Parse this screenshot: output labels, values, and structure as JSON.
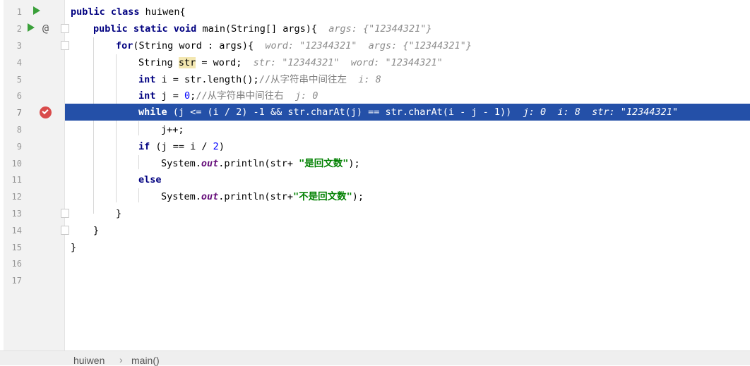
{
  "editor": {
    "lines": [
      {
        "n": "1"
      },
      {
        "n": "2"
      },
      {
        "n": "3"
      },
      {
        "n": "4"
      },
      {
        "n": "5"
      },
      {
        "n": "6"
      },
      {
        "n": "7"
      },
      {
        "n": "8"
      },
      {
        "n": "9"
      },
      {
        "n": "10"
      },
      {
        "n": "11"
      },
      {
        "n": "12"
      },
      {
        "n": "13"
      },
      {
        "n": "14"
      },
      {
        "n": "15"
      },
      {
        "n": "16"
      },
      {
        "n": "17"
      }
    ],
    "code": {
      "l1": {
        "kw": "public class",
        "rest": " huiwen{"
      },
      "l2": {
        "kw": "public static void",
        "rest": " main(String[] args){",
        "hint": "args: {\"12344321\"}"
      },
      "l3": {
        "kw": "for",
        "rest": "(String word : args){",
        "hint": "word: \"12344321\"  args: {\"12344321\"}"
      },
      "l4": {
        "pre": "String ",
        "word": "str",
        "rest": " = word;",
        "hint": "str: \"12344321\"  word: \"12344321\""
      },
      "l5": {
        "kw": "int",
        "rest": " i = str.length();",
        "comment": "//从字符串中间往左",
        "hint": "i: 8"
      },
      "l6": {
        "kw": "int",
        "rest": " j = ",
        "num": "0",
        "rest2": ";",
        "comment": "//从字符串中间往右",
        "hint": "j: 0"
      },
      "l7": {
        "kw": "while",
        "rest": " (j <= (i / 2) -1 && str.charAt(j) == str.charAt(i - j - 1))",
        "hint": "j: 0  i: 8  str: \"12344321\""
      },
      "l8": {
        "rest": "j++;"
      },
      "l9": {
        "kw": "if",
        "rest": " (j == i / ",
        "num": "2",
        "rest2": ")"
      },
      "l10": {
        "pre": "System.",
        "field": "out",
        "rest": ".println(str+ ",
        "str": "\"是回文数\"",
        "rest2": ");"
      },
      "l11": {
        "kw": "else"
      },
      "l12": {
        "pre": "System.",
        "field": "out",
        "rest": ".println(str+",
        "str": "\"不是回文数\"",
        "rest2": ");"
      },
      "l13": {
        "rest": "}"
      },
      "l14": {
        "rest": "}"
      },
      "l15": {
        "rest": "}"
      }
    }
  },
  "breadcrumb": {
    "items": [
      "huiwen",
      "main()"
    ],
    "separator": "›"
  },
  "colors": {
    "execution_line": "#2450a8",
    "breakpoint": "#d94b4b",
    "run_icon": "#3aa03a"
  }
}
